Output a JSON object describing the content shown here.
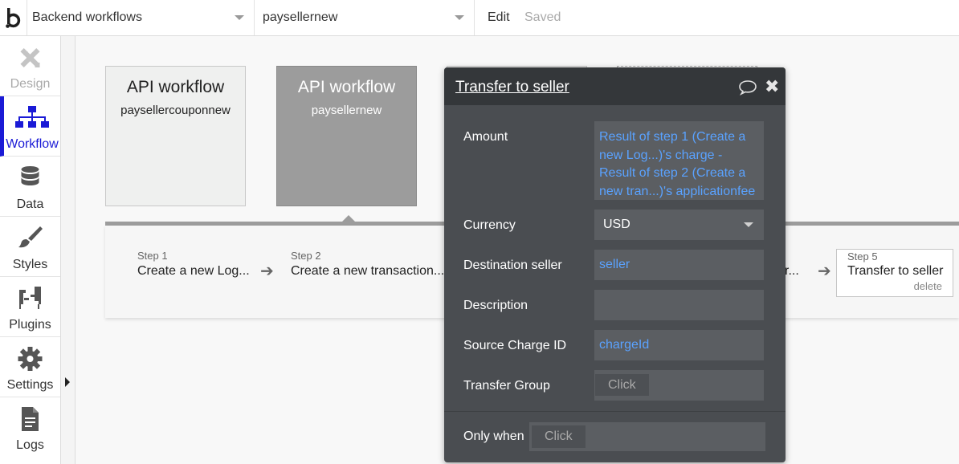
{
  "topbar": {
    "page_selector": "Backend workflows",
    "workflow_selector": "paysellernew",
    "edit_label": "Edit",
    "saved_label": "Saved"
  },
  "leftnav": {
    "items": [
      {
        "label": "Design",
        "icon": "design-icon",
        "state": "disabled"
      },
      {
        "label": "Workflow",
        "icon": "workflow-icon",
        "state": "active"
      },
      {
        "label": "Data",
        "icon": "database-icon",
        "state": "normal"
      },
      {
        "label": "Styles",
        "icon": "brush-icon",
        "state": "normal"
      },
      {
        "label": "Plugins",
        "icon": "plug-icon",
        "state": "normal"
      },
      {
        "label": "Settings",
        "icon": "gear-icon",
        "state": "normal"
      },
      {
        "label": "Logs",
        "icon": "document-icon",
        "state": "normal"
      }
    ]
  },
  "canvas": {
    "workflows": [
      {
        "title": "API workflow",
        "name": "paysellercouponnew",
        "selected": false
      },
      {
        "title": "API workflow",
        "name": "paysellernew",
        "selected": true
      }
    ],
    "steps": [
      {
        "number": "Step 1",
        "label": "Create a new Log..."
      },
      {
        "number": "Step 2",
        "label": "Create a new transaction..."
      },
      {
        "number": "",
        "label": "r..."
      },
      {
        "number": "Step 5",
        "label": "Transfer to seller",
        "action": "delete"
      }
    ]
  },
  "editor": {
    "title": "Transfer to seller",
    "fields": {
      "amount_label": "Amount",
      "amount_value": "Result of step 1 (Create a new Log...)'s charge - Result of step 2 (Create a new tran...)'s applicationfee",
      "currency_label": "Currency",
      "currency_value": "USD",
      "destination_label": "Destination seller",
      "destination_value": "seller",
      "description_label": "Description",
      "description_value": "",
      "source_charge_label": "Source Charge ID",
      "source_charge_value": "chargeId",
      "transfer_group_label": "Transfer Group",
      "transfer_group_placeholder": "Click",
      "only_when_label": "Only when",
      "only_when_placeholder": "Click"
    }
  },
  "colors": {
    "accent": "#1a1ad6",
    "editor_bg": "#4a4d51",
    "editor_header": "#34373a",
    "dynamic_text": "#5aa2ff"
  }
}
